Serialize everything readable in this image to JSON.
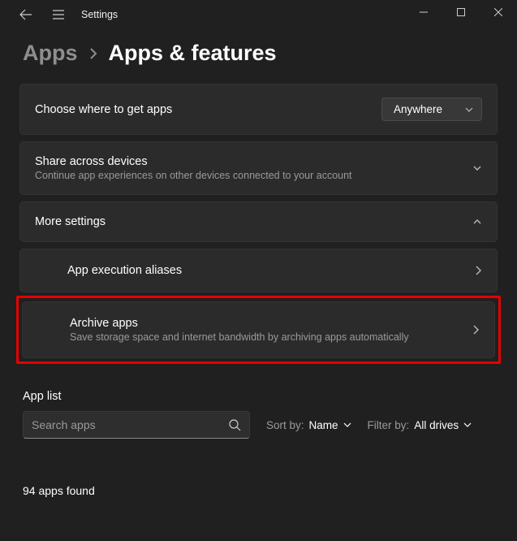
{
  "titlebar": {
    "title": "Settings"
  },
  "breadcrumb": {
    "parent": "Apps",
    "current": "Apps & features"
  },
  "cards": {
    "getApps": {
      "title": "Choose where to get apps",
      "dropdown": "Anywhere"
    },
    "share": {
      "title": "Share across devices",
      "sub": "Continue app experiences on other devices connected to your account"
    },
    "more": {
      "title": "More settings"
    },
    "aliases": {
      "title": "App execution aliases"
    },
    "archive": {
      "title": "Archive apps",
      "sub": "Save storage space and internet bandwidth by archiving apps automatically"
    }
  },
  "appList": {
    "heading": "App list",
    "searchPlaceholder": "Search apps",
    "sortLabel": "Sort by:",
    "sortValue": "Name",
    "filterLabel": "Filter by:",
    "filterValue": "All drives",
    "count": "94 apps found"
  }
}
